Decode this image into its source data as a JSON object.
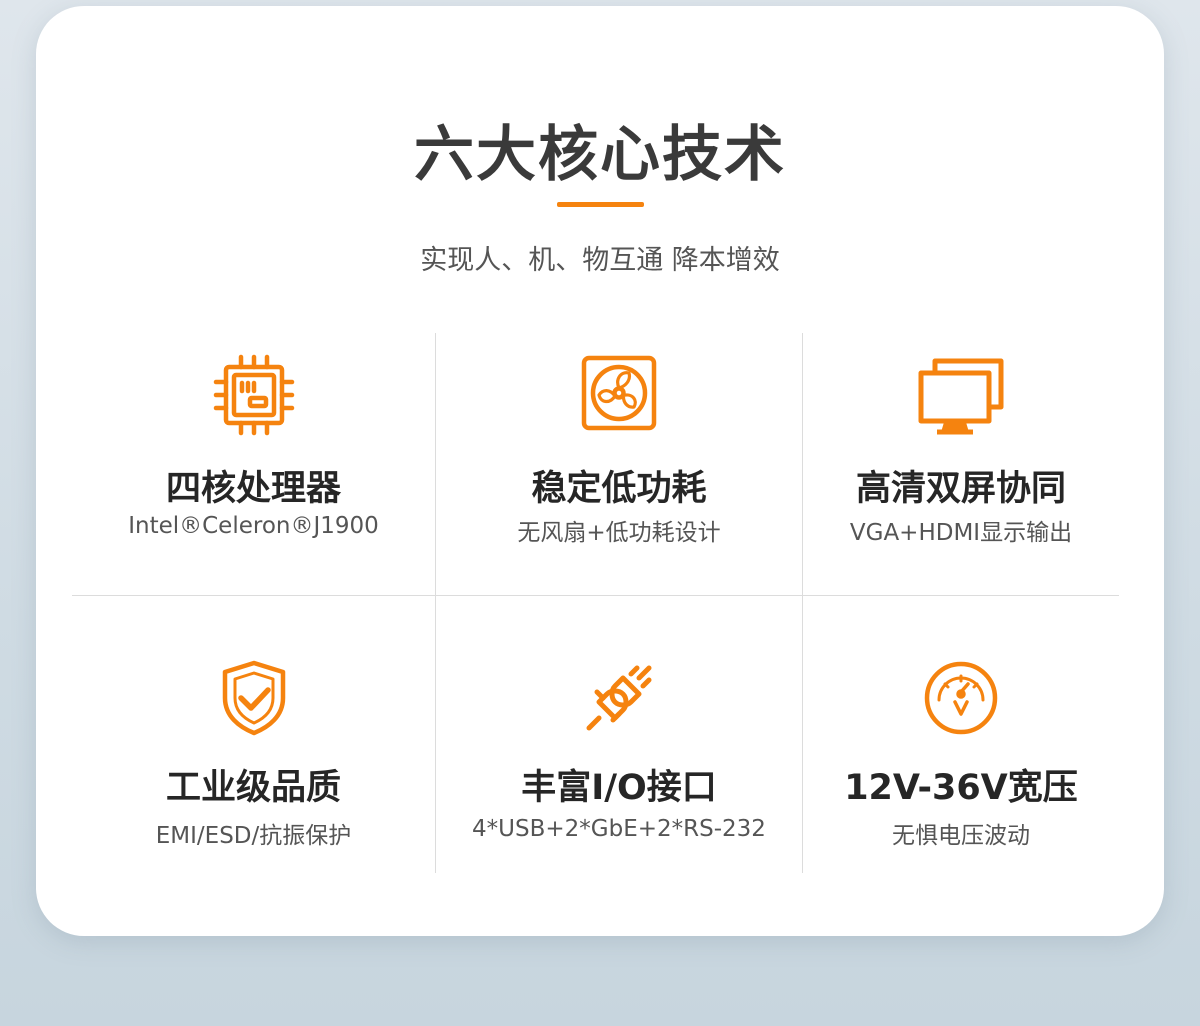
{
  "header": {
    "title": "六大核心技术",
    "subtitle": "实现人、机、物互通 降本增效"
  },
  "accent_color": "#f5830f",
  "features": [
    {
      "icon": "cpu-chip-icon",
      "name": "四核处理器",
      "desc": "Intel®Celeron®J1900"
    },
    {
      "icon": "fan-icon",
      "name": "稳定低功耗",
      "desc": "无风扇+低功耗设计"
    },
    {
      "icon": "dual-monitor-icon",
      "name": "高清双屏协同",
      "desc": "VGA+HDMI显示输出"
    },
    {
      "icon": "shield-check-icon",
      "name": "工业级品质",
      "desc": "EMI/ESD/抗振保护"
    },
    {
      "icon": "plug-connector-icon",
      "name": "丰富I/O接口",
      "desc": "4*USB+2*GbE+2*RS-232"
    },
    {
      "icon": "voltage-gauge-icon",
      "name": "12V-36V宽压",
      "desc": "无惧电压波动"
    }
  ]
}
